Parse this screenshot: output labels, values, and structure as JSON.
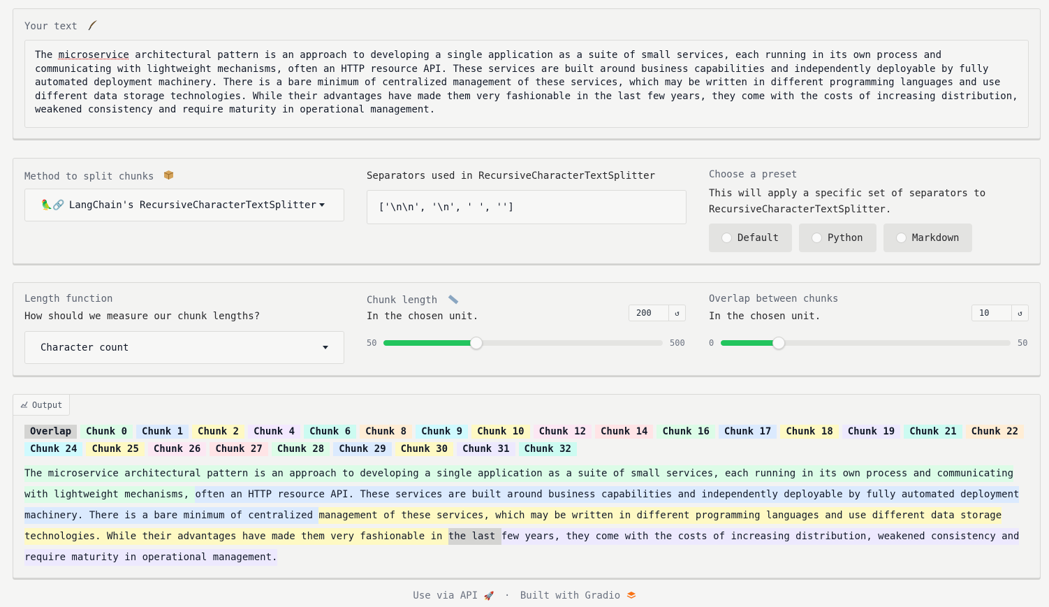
{
  "text_panel": {
    "label": "Your text",
    "label_icon": "feather-pen-icon",
    "content_first_word": "The ",
    "content_misspelled": "microservice",
    "content_rest": " architectural pattern is an approach to developing a single application as a suite of small services, each running in its own process and communicating with lightweight mechanisms, often an HTTP resource API. These services are built around business capabilities and independently deployable by fully automated deployment machinery. There is a bare minimum of centralized management of these services, which may be written in different programming languages and use different data storage technologies. While their advantages have made them very fashionable in the last few years, they come with the costs of increasing distribution, weakened consistency and require maturity in operational management."
  },
  "method": {
    "label": "Method to split chunks",
    "label_icon": "package-box-icon",
    "selected": "LangChain's RecursiveCharacterTextSplitter",
    "selected_icons": "🦜🔗"
  },
  "separators": {
    "label": "Separators used in RecursiveCharacterTextSplitter",
    "value": "['\\n\\n', '\\n', ' ', '']"
  },
  "preset": {
    "label": "Choose a preset",
    "info": "This will apply a specific set of separators to RecursiveCharacterTextSplitter.",
    "options": [
      "Default",
      "Python",
      "Markdown"
    ]
  },
  "length_function": {
    "label": "Length function",
    "info": "How should we measure our chunk lengths?",
    "selected": "Character count"
  },
  "chunk_length": {
    "label": "Chunk length",
    "label_icon": "ruler-icon",
    "info": "In the chosen unit.",
    "value": "200",
    "min": "50",
    "max": "500",
    "fraction": 0.3333
  },
  "overlap": {
    "label": "Overlap between chunks",
    "info": "In the chosen unit.",
    "value": "10",
    "min": "0",
    "max": "50",
    "fraction": 0.2
  },
  "output": {
    "tab_label": "Output",
    "legend": [
      {
        "label": "Overlap",
        "cls": "ov"
      },
      {
        "label": "Chunk 0",
        "cls": "c0"
      },
      {
        "label": "Chunk 1",
        "cls": "c1"
      },
      {
        "label": "Chunk 2",
        "cls": "c2"
      },
      {
        "label": "Chunk 4",
        "cls": "c3"
      },
      {
        "label": "Chunk 6",
        "cls": "c4"
      },
      {
        "label": "Chunk 8",
        "cls": "c5"
      },
      {
        "label": "Chunk 9",
        "cls": "c6"
      },
      {
        "label": "Chunk 10",
        "cls": "c2"
      },
      {
        "label": "Chunk 12",
        "cls": "c7"
      },
      {
        "label": "Chunk 14",
        "cls": "c8"
      },
      {
        "label": "Chunk 16",
        "cls": "c0"
      },
      {
        "label": "Chunk 17",
        "cls": "c1"
      },
      {
        "label": "Chunk 18",
        "cls": "c2"
      },
      {
        "label": "Chunk 19",
        "cls": "c9"
      },
      {
        "label": "Chunk 21",
        "cls": "c4"
      },
      {
        "label": "Chunk 22",
        "cls": "c5"
      },
      {
        "label": "Chunk 24",
        "cls": "c6"
      },
      {
        "label": "Chunk 25",
        "cls": "c2"
      },
      {
        "label": "Chunk 26",
        "cls": "c7"
      },
      {
        "label": "Chunk 27",
        "cls": "c8"
      },
      {
        "label": "Chunk 28",
        "cls": "c0"
      },
      {
        "label": "Chunk 29",
        "cls": "c1"
      },
      {
        "label": "Chunk 30",
        "cls": "c2"
      },
      {
        "label": "Chunk 31",
        "cls": "c9"
      },
      {
        "label": "Chunk 32",
        "cls": "c4"
      }
    ],
    "segments": [
      {
        "text": " The microservice architectural pattern is an approach to developing a single application as a suite of small services, each running in its own process and communicating with lightweight mechanisms, ",
        "cls": "c0"
      },
      {
        "text": " ",
        "cls": ""
      },
      {
        "text": " often an HTTP resource API. These services are built around business capabilities and independently deployable by fully automated deployment machinery. There is a bare minimum of centralized ",
        "cls": "c1"
      },
      {
        "text": " ",
        "cls": ""
      },
      {
        "text": " management of these services, which may be written in different programming languages and use different data storage technologies. While their advantages have made them very fashionable in ",
        "cls": "c2"
      },
      {
        "text": " ",
        "cls": ""
      },
      {
        "text": " the last ",
        "cls": "ov"
      },
      {
        "text": " ",
        "cls": ""
      },
      {
        "text": " few years, they come with the costs of increasing distribution, weakened consistency and require maturity in operational management.",
        "cls": "c9"
      }
    ]
  },
  "footer": {
    "api_text": "Use via API",
    "separator": "·",
    "built_text": "Built with Gradio"
  }
}
